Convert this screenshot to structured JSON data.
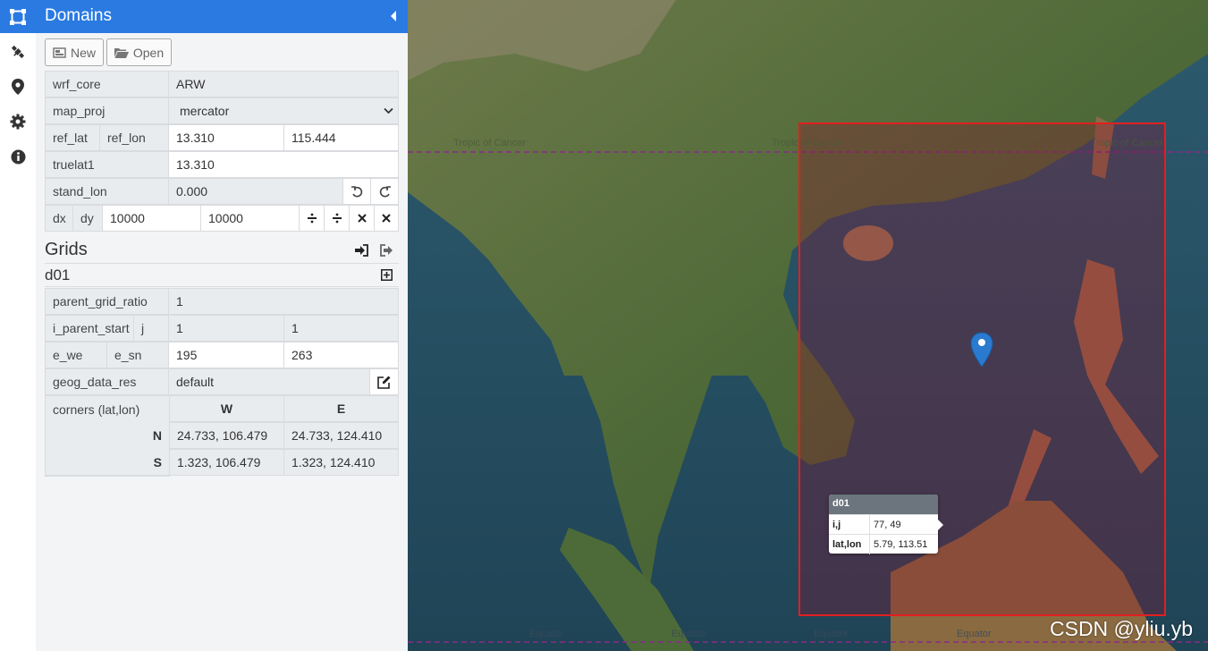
{
  "panel": {
    "title": "Domains",
    "new_label": "New",
    "open_label": "Open"
  },
  "domain": {
    "wrf_core_label": "wrf_core",
    "wrf_core_value": "ARW",
    "map_proj_label": "map_proj",
    "map_proj_value": "mercator",
    "ref_lat_label": "ref_lat",
    "ref_lon_label": "ref_lon",
    "ref_lat_value": "13.310",
    "ref_lon_value": "115.444",
    "truelat1_label": "truelat1",
    "truelat1_value": "13.310",
    "stand_lon_label": "stand_lon",
    "stand_lon_value": "0.000",
    "dx_label": "dx",
    "dy_label": "dy",
    "dx_value": "10000",
    "dy_value": "10000"
  },
  "grids": {
    "title": "Grids",
    "grid_name": "d01",
    "parent_grid_ratio_label": "parent_grid_ratio",
    "parent_grid_ratio_value": "1",
    "i_parent_start_label": "i_parent_start",
    "j_label": "j",
    "i_parent_start_value": "1",
    "j_parent_start_value": "1",
    "e_we_label": "e_we",
    "e_sn_label": "e_sn",
    "e_we_value": "195",
    "e_sn_value": "263",
    "geog_data_res_label": "geog_data_res",
    "geog_data_res_value": "default",
    "corners_label": "corners (lat,lon)",
    "col_w": "W",
    "col_e": "E",
    "row_n": "N",
    "row_s": "S",
    "nw": "24.733, 106.479",
    "ne": "24.733, 124.410",
    "sw": "1.323, 106.479",
    "se": "1.323, 124.410"
  },
  "map": {
    "tropic_label": "Tropic of Cancer",
    "equator_label": "Equator",
    "domain_color": "#e02020",
    "popup": {
      "title": "d01",
      "ij_label": "i,j",
      "ij_value": "77, 49",
      "latlon_label": "lat,lon",
      "latlon_value": "5.79, 113.51"
    },
    "watermark": "CSDN @yliu.yb"
  },
  "icons": {
    "rail": [
      "domain-icon",
      "satellite-icon",
      "map-marker-icon",
      "gear-icon",
      "info-icon"
    ],
    "accent": "#2a7ae2"
  }
}
